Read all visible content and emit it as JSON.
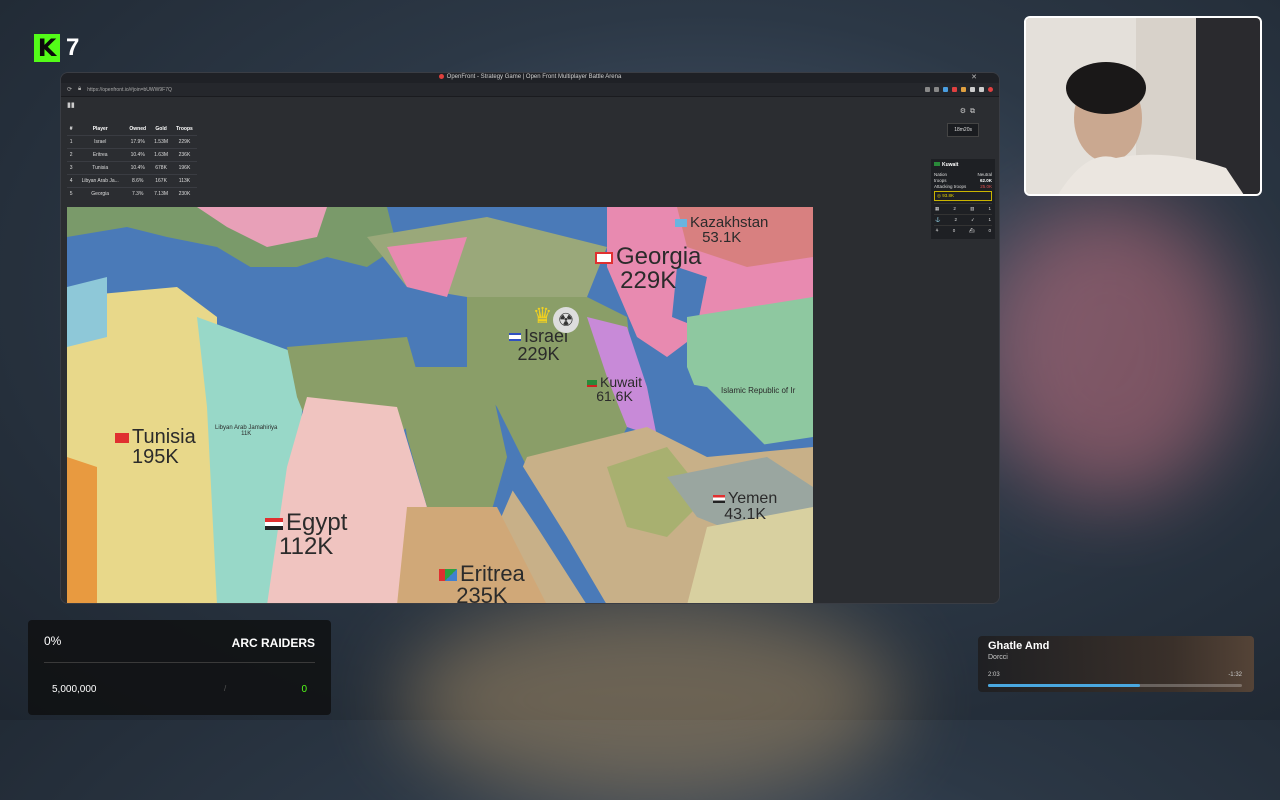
{
  "stream": {
    "logo_letter": "K",
    "viewer_count": "7",
    "logo_color": "#53fc18"
  },
  "browser": {
    "tab_title": "OpenFront - Strategy Game | Open Front Multiplayer Battle Arena",
    "url": "https://openfront.io/#join=bUWW9F7Q"
  },
  "leaderboard": {
    "toggle_icon": "bar-chart-icon",
    "headers": [
      "#",
      "Player",
      "Owned",
      "Gold",
      "Troops"
    ],
    "rows": [
      {
        "rank": "1",
        "player": "Israel",
        "owned": "17.9%",
        "gold": "1.53M",
        "troops": "229K"
      },
      {
        "rank": "2",
        "player": "Eritrea",
        "owned": "10.4%",
        "gold": "1.63M",
        "troops": "236K"
      },
      {
        "rank": "3",
        "player": "Tunisia",
        "owned": "10.4%",
        "gold": "678K",
        "troops": "196K"
      },
      {
        "rank": "4",
        "player": "Libyan Arab Ja...",
        "owned": "8.6%",
        "gold": "167K",
        "troops": "113K"
      },
      {
        "rank": "5",
        "player": "Georgia",
        "owned": "7.3%",
        "gold": "7.13M",
        "troops": "230K"
      }
    ]
  },
  "hud": {
    "timer": "18m20s"
  },
  "info_panel": {
    "name": "Kuwait",
    "rows": [
      {
        "label": "Nation",
        "value": "Neutral"
      },
      {
        "label": "troops",
        "value": "62.0K"
      },
      {
        "label": "Attacking troops",
        "value": "25.0K"
      }
    ],
    "gold": "93.8K",
    "actions": [
      {
        "left": "2",
        "right": "1"
      },
      {
        "left": "2",
        "right": "1"
      },
      {
        "left": "0",
        "right": "0"
      }
    ]
  },
  "map_labels": [
    {
      "name": "Kazakhstan",
      "troops": "53.1K"
    },
    {
      "name": "Georgia",
      "troops": "229K"
    },
    {
      "name": "Israel",
      "troops": "229K"
    },
    {
      "name": "Kuwait",
      "troops": "61.6K"
    },
    {
      "name": "Islamic Republic of Ir",
      "troops": ""
    },
    {
      "name": "Tunisia",
      "troops": "195K"
    },
    {
      "name": "Libyan Arab Jamahiriya",
      "troops": "11K"
    },
    {
      "name": "Egypt",
      "troops": "112K"
    },
    {
      "name": "Yemen",
      "troops": "43.1K"
    },
    {
      "name": "Eritrea",
      "troops": "235K"
    }
  ],
  "goal": {
    "percent": "0%",
    "title": "ARC RAIDERS",
    "target": "5,000,000",
    "separator": "/",
    "current": "0",
    "progress": 0
  },
  "music": {
    "title": "Ghatle Amd",
    "artist": "Dorcci",
    "elapsed": "2:03",
    "remaining": "-1:32",
    "progress": 0.6
  }
}
